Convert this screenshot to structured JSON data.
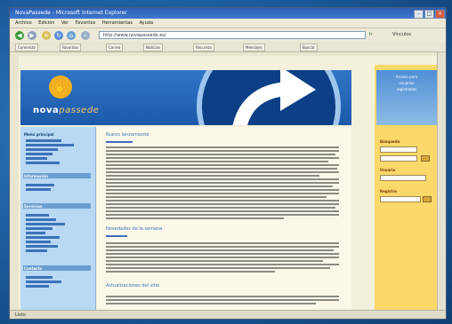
{
  "window": {
    "title": "NovaPassede - Microsoft Internet Explorer"
  },
  "menu": {
    "items": [
      "Archivo",
      "Edición",
      "Ver",
      "Favoritos",
      "Herramientas",
      "Ayuda"
    ]
  },
  "navigation": {
    "address": "http://www.novapassede.es/",
    "go_label": "Ir",
    "links_label": "Vínculos"
  },
  "bookmarks": [
    "Comienzo",
    "Favoritos",
    "Correo",
    "Noticias",
    "Recursos",
    "Mensajes",
    "Buscar"
  ],
  "site": {
    "logo_main": "nova",
    "logo_accent": "passede"
  },
  "left_nav": {
    "sections": [
      "Menú principal",
      "Información",
      "Servicios",
      "Contacto"
    ]
  },
  "content": {
    "headings": [
      "Nuevo lanzamiento",
      "Novedades de la semana",
      "Actualizaciones del sitio"
    ]
  },
  "right_col": {
    "header_lines": [
      "Acceso para",
      "usuarios",
      "registrados"
    ],
    "labels": [
      "Búsqueda",
      "Usuario",
      "Registro"
    ]
  },
  "status": {
    "text": "Listo"
  },
  "colors": {
    "desktop": "#1a5a9a",
    "header_blue": "#1d5aaa",
    "right_yellow": "#fbd86a"
  }
}
